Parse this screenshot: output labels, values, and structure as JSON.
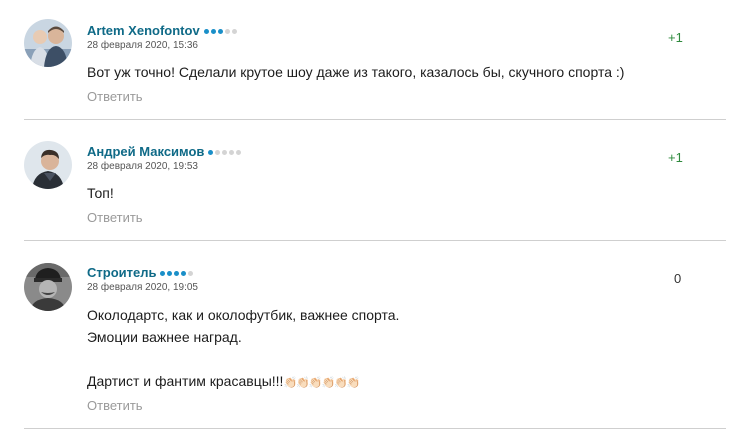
{
  "comments": [
    {
      "author": "Artem Xenofontov",
      "level": 3,
      "date": "28 февраля 2020, 15:36",
      "rating": "+1",
      "lines": [
        "Вот уж точно! Сделали крутое шоу даже из такого, казалось бы, скучного спорта :)"
      ],
      "reply_label": "Ответить"
    },
    {
      "author": "Андрей Максимов",
      "level": 1,
      "date": "28 февраля 2020, 19:53",
      "rating": "+1",
      "lines": [
        "Топ!"
      ],
      "reply_label": "Ответить"
    },
    {
      "author": "Строитель",
      "level": 4,
      "date": "28 февраля 2020, 19:05",
      "rating": "0",
      "lines": [
        "Околодартс, как и околофутбик, важнее спорта.",
        "Эмоции важнее наград.",
        "",
        "Дартист и фантим красавцы!!!"
      ],
      "emoji_tail": "👏🏻👏🏻👏🏻👏🏻👏🏻👏🏻",
      "reply_label": "Ответить"
    }
  ],
  "colors": {
    "author": "#0f6a87",
    "level_dot_active": "#1a8fc8",
    "level_dot_inactive": "#d4d4d4",
    "rating_positive": "#2f8a3e",
    "reply": "#9a9a9a",
    "divider": "#cfcfcf"
  },
  "icons": {
    "level_indicator": "level-dots-icon"
  }
}
